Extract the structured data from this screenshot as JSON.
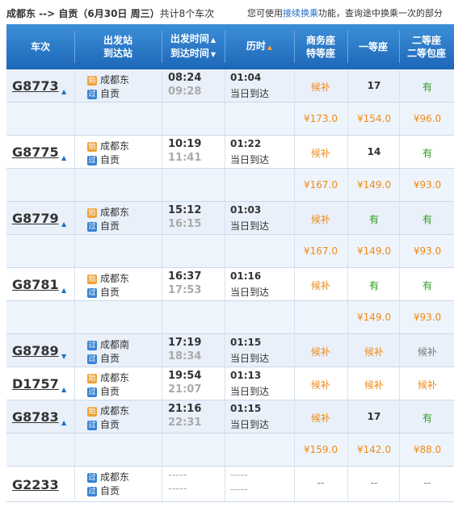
{
  "header": {
    "route": "成都东 --> 自贡（6月30日 周三）",
    "count": "共计8个车次",
    "hint_prefix": "您可使用",
    "hint_link": "接续换乘",
    "hint_suffix": "功能，查询途中换乘一次的部分"
  },
  "columns": {
    "train": "车次",
    "station_1": "出发站",
    "station_2": "到达站",
    "time_1": "出发时间",
    "time_2": "到达时间",
    "duration": "历时",
    "biz_1": "商务座",
    "biz_2": "特等座",
    "first": "一等座",
    "second_1": "二等座",
    "second_2": "二等包座"
  },
  "badges": {
    "start": "始",
    "pass": "过"
  },
  "trains": [
    {
      "no": "G8773",
      "from": "成都东",
      "to": "自贡",
      "from_badge": "始",
      "dep": "08:24",
      "arr": "09:28",
      "dur": "01:04",
      "day": "当日到达",
      "biz": "候补",
      "first": "17",
      "second": "有",
      "biz_price": "¥173.0",
      "first_price": "¥154.0",
      "second_price": "¥96.0"
    },
    {
      "no": "G8775",
      "from": "成都东",
      "to": "自贡",
      "from_badge": "始",
      "dep": "10:19",
      "arr": "11:41",
      "dur": "01:22",
      "day": "当日到达",
      "biz": "候补",
      "first": "14",
      "second": "有",
      "biz_price": "¥167.0",
      "first_price": "¥149.0",
      "second_price": "¥93.0"
    },
    {
      "no": "G8779",
      "from": "成都东",
      "to": "自贡",
      "from_badge": "始",
      "dep": "15:12",
      "arr": "16:15",
      "dur": "01:03",
      "day": "当日到达",
      "biz": "候补",
      "first": "有",
      "second": "有",
      "biz_price": "¥167.0",
      "first_price": "¥149.0",
      "second_price": "¥93.0"
    },
    {
      "no": "G8781",
      "from": "成都东",
      "to": "自贡",
      "from_badge": "始",
      "dep": "16:37",
      "arr": "17:53",
      "dur": "01:16",
      "day": "当日到达",
      "biz": "候补",
      "first": "有",
      "second": "有",
      "biz_price": "",
      "first_price": "¥149.0",
      "second_price": "¥93.0"
    },
    {
      "no": "G8789",
      "from": "成都南",
      "to": "自贡",
      "from_badge": "过",
      "dep": "17:19",
      "arr": "18:34",
      "dur": "01:15",
      "day": "当日到达",
      "biz": "候补",
      "first": "候补",
      "second": "候补"
    },
    {
      "no": "D1757",
      "from": "成都东",
      "to": "自贡",
      "from_badge": "始",
      "dep": "19:54",
      "arr": "21:07",
      "dur": "01:13",
      "day": "当日到达",
      "biz": "候补",
      "first": "候补",
      "second": "候补"
    },
    {
      "no": "G8783",
      "from": "成都东",
      "to": "自贡",
      "from_badge": "始",
      "dep": "21:16",
      "arr": "22:31",
      "dur": "01:15",
      "day": "当日到达",
      "biz": "候补",
      "first": "17",
      "second": "有",
      "biz_price": "¥159.0",
      "first_price": "¥142.0",
      "second_price": "¥88.0"
    },
    {
      "no": "G2233",
      "from": "成都东",
      "to": "自贡",
      "from_badge": "过",
      "dep": "-----",
      "arr": "-----",
      "dur": "-----",
      "day": "-----",
      "biz": "--",
      "first": "--",
      "second": "--"
    }
  ],
  "colors": {
    "header_blue": "#1d67b8",
    "orange": "#f08a15",
    "green": "#2e9b1f",
    "link": "#1b6fc6"
  }
}
